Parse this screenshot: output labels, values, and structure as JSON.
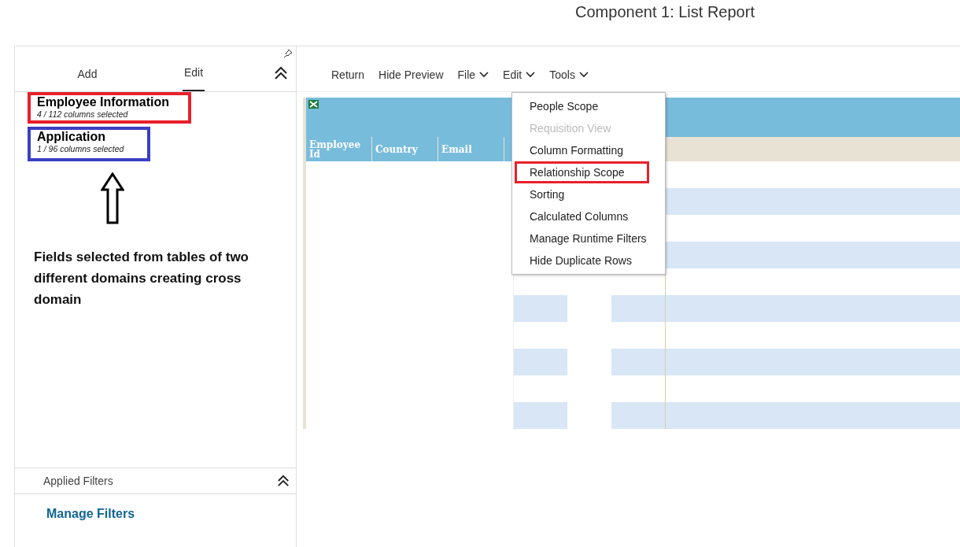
{
  "page_title": "Component 1: List Report",
  "panel_tabs": [
    {
      "label": "Add",
      "selected": false
    },
    {
      "label": "Edit",
      "selected": true
    }
  ],
  "tables": [
    {
      "name": "Employee Information",
      "summary": "4 / 112 columns selected",
      "color": "#e8202a"
    },
    {
      "name": "Application",
      "summary": "1 / 96 columns selected",
      "color": "#3a3fc4"
    }
  ],
  "annotation": "Fields selected from tables of two different domains creating cross domain",
  "applied_filters": {
    "label": "Applied Filters"
  },
  "manage_filters": "Manage Filters",
  "toolbar": [
    {
      "label": "Return",
      "dropdown": false
    },
    {
      "label": "Hide Preview",
      "dropdown": false
    },
    {
      "label": "File",
      "dropdown": true
    },
    {
      "label": "Edit",
      "dropdown": true
    },
    {
      "label": "Tools",
      "dropdown": true
    }
  ],
  "table": {
    "columns": [
      "Employee Id",
      "Country",
      "Email"
    ]
  },
  "edit_menu": [
    {
      "label": "People Scope",
      "disabled": false,
      "highlighted": false
    },
    {
      "label": "Requisition View",
      "disabled": true,
      "highlighted": false
    },
    {
      "label": "Column Formatting",
      "disabled": false,
      "highlighted": false
    },
    {
      "label": "Relationship Scope",
      "disabled": false,
      "highlighted": true
    },
    {
      "label": "Sorting",
      "disabled": false,
      "highlighted": false
    },
    {
      "label": "Calculated Columns",
      "disabled": false,
      "highlighted": false
    },
    {
      "label": "Manage Runtime Filters",
      "disabled": false,
      "highlighted": false
    },
    {
      "label": "Hide Duplicate Rows",
      "disabled": false,
      "highlighted": false
    }
  ]
}
